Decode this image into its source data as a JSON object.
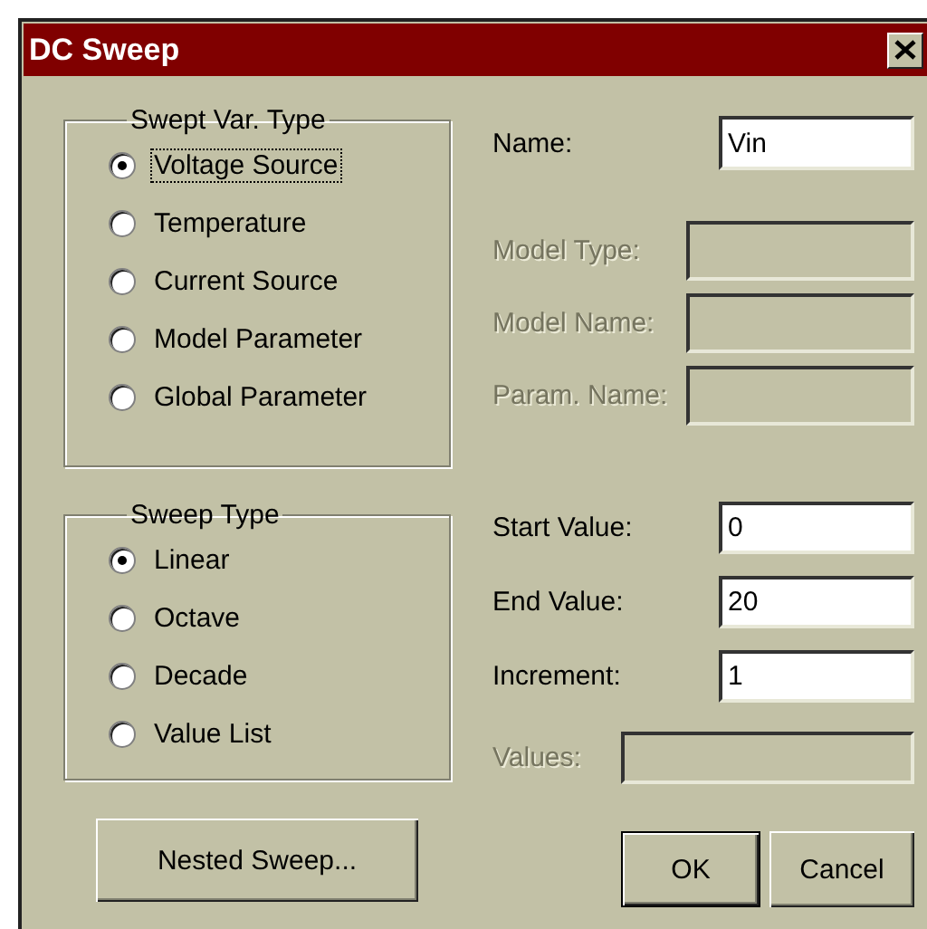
{
  "window": {
    "title": "DC Sweep"
  },
  "swept_var_type": {
    "title": "Swept Var. Type",
    "options": [
      {
        "label": "Voltage Source",
        "selected": true,
        "focused": true
      },
      {
        "label": "Temperature",
        "selected": false,
        "focused": false
      },
      {
        "label": "Current Source",
        "selected": false,
        "focused": false
      },
      {
        "label": "Model Parameter",
        "selected": false,
        "focused": false
      },
      {
        "label": "Global Parameter",
        "selected": false,
        "focused": false
      }
    ]
  },
  "sweep_type": {
    "title": "Sweep Type",
    "options": [
      {
        "label": "Linear",
        "selected": true,
        "focused": false
      },
      {
        "label": "Octave",
        "selected": false,
        "focused": false
      },
      {
        "label": "Decade",
        "selected": false,
        "focused": false
      },
      {
        "label": "Value List",
        "selected": false,
        "focused": false
      }
    ]
  },
  "name_field": {
    "label": "Name:",
    "value": "Vin",
    "disabled": false
  },
  "model_fields": [
    {
      "label": "Model Type:",
      "disabled": true
    },
    {
      "label": "Model Name:",
      "disabled": true
    },
    {
      "label": "Param. Name:",
      "disabled": true
    }
  ],
  "sweep_fields": [
    {
      "label": "Start Value:",
      "value": "0",
      "disabled": false
    },
    {
      "label": "End Value:",
      "value": "20",
      "disabled": false
    },
    {
      "label": "Increment:",
      "value": "1",
      "disabled": false
    }
  ],
  "values_field": {
    "label": "Values:",
    "disabled": true
  },
  "buttons": [
    {
      "label": "Nested Sweep...",
      "default": false
    },
    {
      "label": "OK",
      "default": true
    },
    {
      "label": "Cancel",
      "default": false
    }
  ]
}
